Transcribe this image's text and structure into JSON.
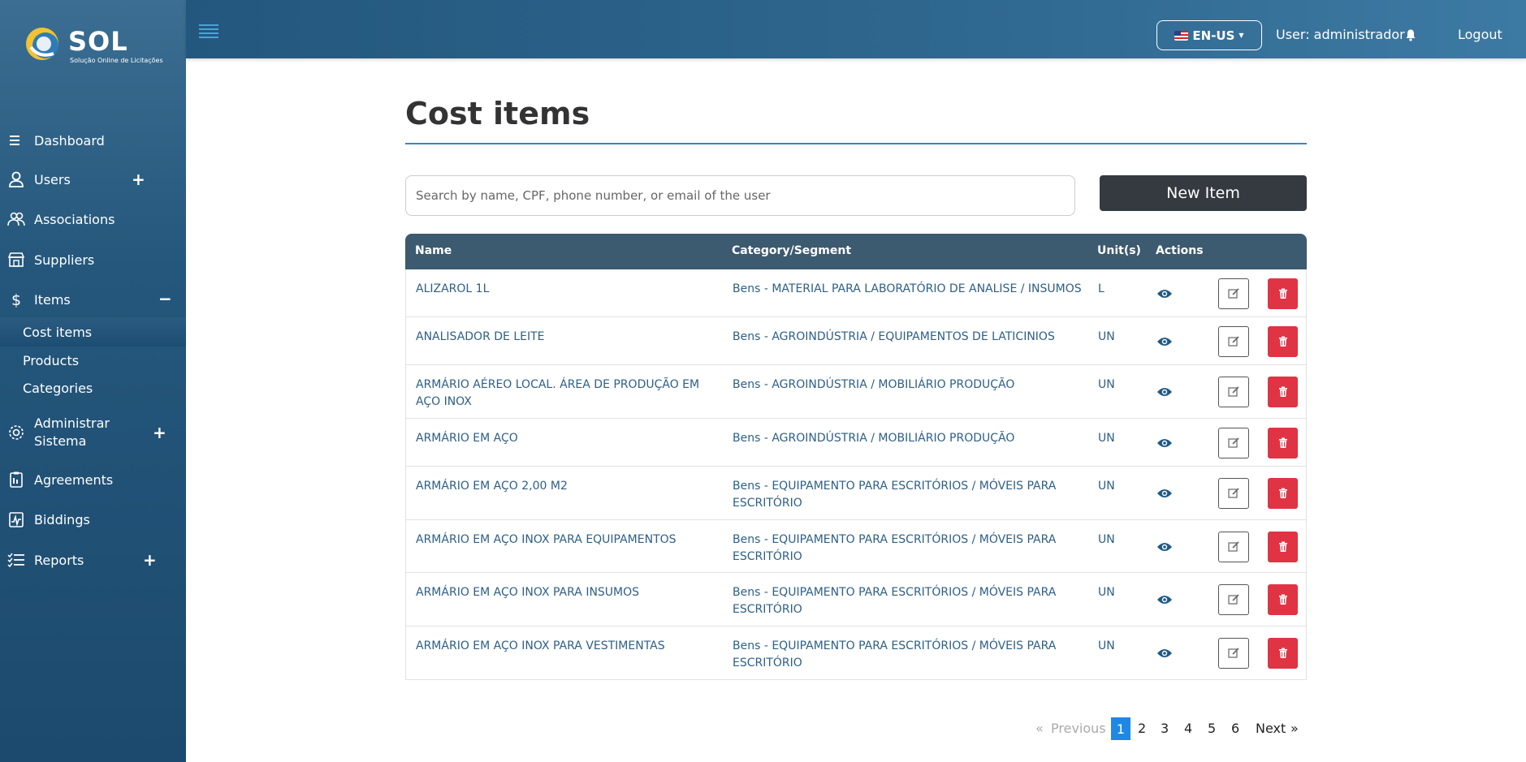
{
  "brand": {
    "name": "SOL",
    "tagline": "Solução Online de Licitações",
    "colors": {
      "sidebar": "#25577c",
      "header": "#2f6890",
      "accent": "#1e88e5",
      "danger": "#e03444",
      "dark_button": "#343a40"
    }
  },
  "header": {
    "language": "EN-US",
    "user": "User: administrador",
    "logout": "Logout"
  },
  "sidebar": {
    "items": [
      {
        "label": "Dashboard",
        "icon": "list-icon"
      },
      {
        "label": "Users",
        "icon": "user-icon",
        "toggle": "+"
      },
      {
        "label": "Associations",
        "icon": "users-icon"
      },
      {
        "label": "Suppliers",
        "icon": "store-icon"
      },
      {
        "label": "Items",
        "icon": "dollar-icon",
        "toggle": "−"
      },
      {
        "label": "Administrar Sistema",
        "icon": "gear-icon",
        "toggle": "+"
      },
      {
        "label": "Agreements",
        "icon": "clipboard-icon"
      },
      {
        "label": "Biddings",
        "icon": "chart-clipboard-icon"
      },
      {
        "label": "Reports",
        "icon": "checklist-icon",
        "toggle": "+"
      }
    ],
    "sub_items": [
      "Cost items",
      "Products",
      "Categories"
    ]
  },
  "main": {
    "title": "Cost items",
    "search_placeholder": "Search by name, CPF, phone number, or email of the user",
    "new_button": "New Item",
    "columns": [
      "Name",
      "Category/Segment",
      "Unit(s)",
      "Actions"
    ],
    "rows": [
      {
        "name": "ALIZAROL 1L",
        "category": "Bens - MATERIAL PARA LABORATÓRIO DE ANALISE / INSUMOS",
        "unit": "L"
      },
      {
        "name": "ANALISADOR DE LEITE",
        "category": "Bens - AGROINDÚSTRIA / EQUIPAMENTOS DE LATICINIOS",
        "unit": "UN"
      },
      {
        "name": "ARMÁRIO AÉREO LOCAL. ÁREA DE PRODUÇÃO EM AÇO INOX",
        "category": "Bens - AGROINDÚSTRIA / MOBILIÁRIO PRODUÇÃO",
        "unit": "UN"
      },
      {
        "name": "ARMÁRIO EM AÇO",
        "category": "Bens - AGROINDÚSTRIA / MOBILIÁRIO PRODUÇÃO",
        "unit": "UN"
      },
      {
        "name": "ARMÁRIO EM AÇO 2,00 M2",
        "category": "Bens - EQUIPAMENTO PARA ESCRITÓRIOS / MÓVEIS PARA ESCRITÓRIO",
        "unit": "UN"
      },
      {
        "name": "ARMÁRIO EM AÇO INOX PARA EQUIPAMENTOS",
        "category": "Bens - EQUIPAMENTO PARA ESCRITÓRIOS / MÓVEIS PARA ESCRITÓRIO",
        "unit": "UN"
      },
      {
        "name": "ARMÁRIO EM AÇO INOX PARA INSUMOS",
        "category": "Bens - EQUIPAMENTO PARA ESCRITÓRIOS / MÓVEIS PARA ESCRITÓRIO",
        "unit": "UN"
      },
      {
        "name": "ARMÁRIO EM AÇO INOX PARA VESTIMENTAS",
        "category": "Bens - EQUIPAMENTO PARA ESCRITÓRIOS / MÓVEIS PARA ESCRITÓRIO",
        "unit": "UN"
      }
    ]
  },
  "pagination": {
    "previous": "Previous",
    "next": "Next",
    "pages": [
      "1",
      "2",
      "3",
      "4",
      "5",
      "6"
    ],
    "current": "1",
    "prev_arrow": "«",
    "next_arrow": "»"
  }
}
